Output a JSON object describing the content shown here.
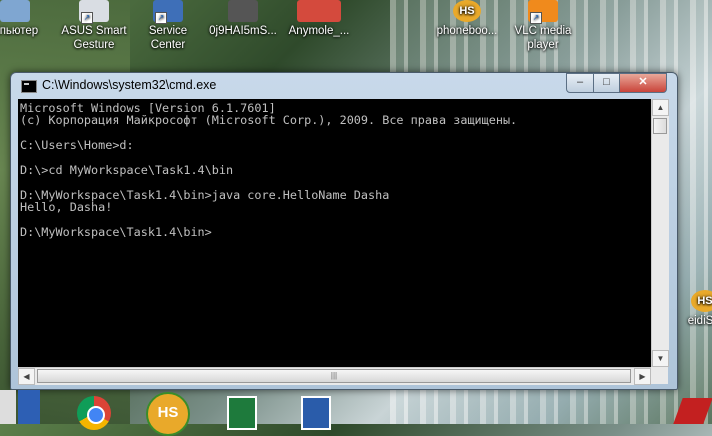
{
  "desktop_icons": [
    {
      "id": "computer",
      "label": "мпьютер"
    },
    {
      "id": "asus",
      "label": "ASUS Smart Gesture"
    },
    {
      "id": "service",
      "label": "Service Center"
    },
    {
      "id": "file",
      "label": "0j9HAI5mS..."
    },
    {
      "id": "anymole",
      "label": "Anymole_..."
    },
    {
      "id": "phonebook",
      "label": "phoneboo..."
    },
    {
      "id": "vlc",
      "label": "VLC media player"
    },
    {
      "id": "heidi",
      "label": "eidiSQ"
    }
  ],
  "window": {
    "title": "C:\\Windows\\system32\\cmd.exe",
    "min_label": "–",
    "max_label": "□",
    "close_label": "✕"
  },
  "console_lines": [
    "Microsoft Windows [Version 6.1.7601]",
    "(c) Корпорация Майкрософт (Microsoft Corp.), 2009. Все права защищены.",
    "",
    "C:\\Users\\Home>d:",
    "",
    "D:\\>cd MyWorkspace\\Task1.4\\bin",
    "",
    "D:\\MyWorkspace\\Task1.4\\bin>java core.HelloName Dasha",
    "Hello, Dasha!",
    "",
    "D:\\MyWorkspace\\Task1.4\\bin>"
  ],
  "taskbar_icons": [
    "chrome-icon",
    "heidisql-icon",
    "excel-icon",
    "word-icon"
  ],
  "heidi_badge": "HS"
}
